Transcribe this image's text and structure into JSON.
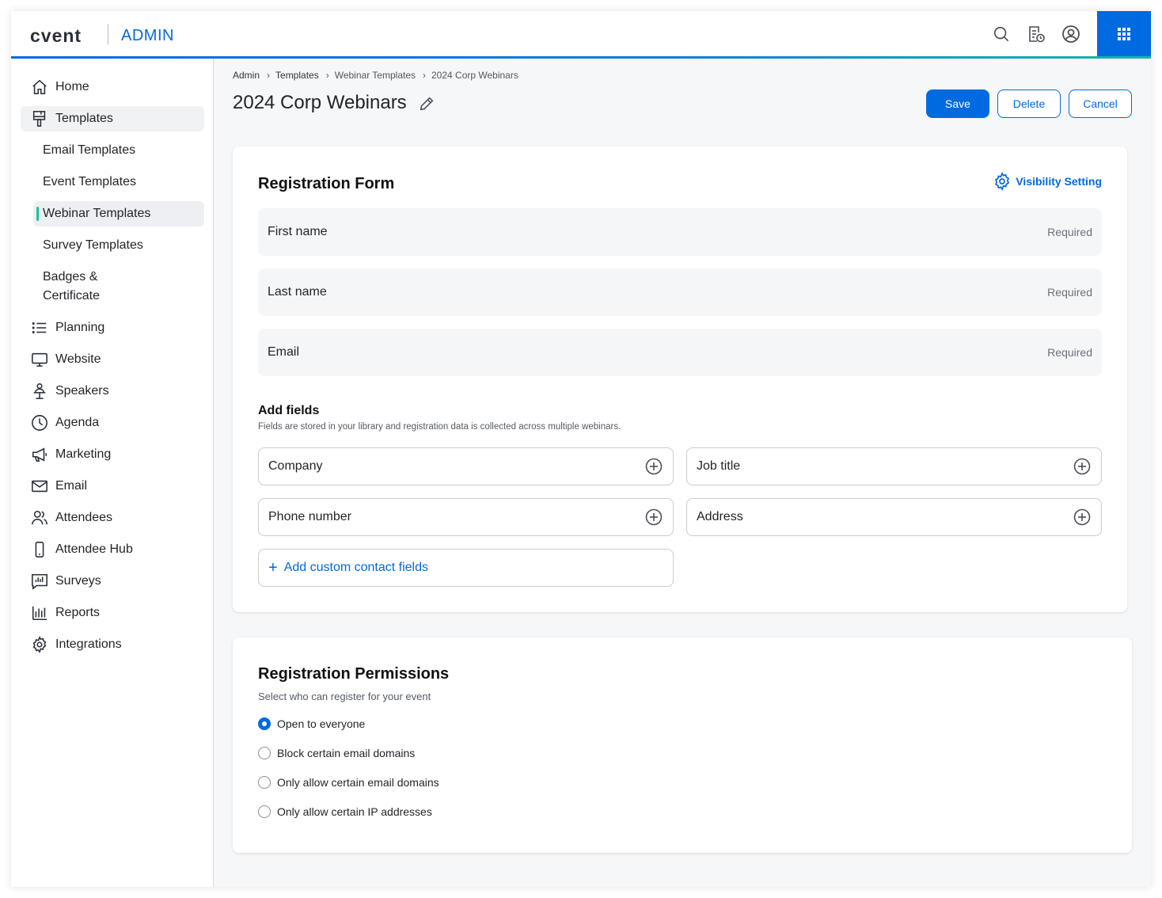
{
  "header": {
    "logo": "cvent",
    "app_label": "ADMIN",
    "icons": [
      "search-icon",
      "report-schedule-icon",
      "user-account-icon",
      "apps-grid-icon"
    ]
  },
  "colors": {
    "brand_blue": "#006ae1",
    "active_marker": "#17c39a"
  },
  "sidebar": {
    "items": [
      {
        "label": "Home",
        "icon": "home-icon"
      },
      {
        "label": "Templates",
        "icon": "paint-brush-icon"
      },
      {
        "label": "Planning",
        "icon": "list-icon"
      },
      {
        "label": "Website",
        "icon": "monitor-icon"
      },
      {
        "label": "Speakers",
        "icon": "speaker-icon"
      },
      {
        "label": "Agenda",
        "icon": "clock-icon"
      },
      {
        "label": "Marketing",
        "icon": "megaphone-icon"
      },
      {
        "label": "Email",
        "icon": "envelope-icon"
      },
      {
        "label": "Attendees",
        "icon": "people-icon"
      },
      {
        "label": "Attendee Hub",
        "icon": "mobile-icon"
      },
      {
        "label": "Surveys",
        "icon": "survey-chart-icon"
      },
      {
        "label": "Reports",
        "icon": "bar-chart-icon"
      },
      {
        "label": "Integrations",
        "icon": "gear-icon"
      }
    ],
    "template_subitems": [
      {
        "label": "Email Templates"
      },
      {
        "label": "Event Templates"
      },
      {
        "label": "Webinar Templates"
      },
      {
        "label": "Survey Templates"
      },
      {
        "label": "Badges & Certificate"
      }
    ]
  },
  "breadcrumb": [
    "Admin",
    "Templates",
    "Webinar Templates",
    "2024 Corp Webinars"
  ],
  "page": {
    "title": "2024 Corp Webinars",
    "save_label": "Save",
    "delete_label": "Delete",
    "cancel_label": "Cancel"
  },
  "registration_form": {
    "title": "Registration Form",
    "visibility_label": "Visibility Setting",
    "required_fields": [
      {
        "name": "First name",
        "status": "Required"
      },
      {
        "name": "Last name",
        "status": "Required"
      },
      {
        "name": "Email",
        "status": "Required"
      }
    ],
    "add_fields_title": "Add fields",
    "add_fields_helper": "Fields are stored in your library and registration data is collected across multiple webinars.",
    "optional_fields": [
      {
        "name": "Company"
      },
      {
        "name": "Job title"
      },
      {
        "name": "Phone number"
      },
      {
        "name": "Address"
      }
    ],
    "custom_fields_label": "Add custom contact fields"
  },
  "permissions": {
    "title": "Registration Permissions",
    "subtitle": "Select who can register for your event",
    "options": [
      {
        "label": "Open to everyone",
        "selected": true
      },
      {
        "label": "Block certain email domains",
        "selected": false
      },
      {
        "label": "Only allow certain email domains",
        "selected": false
      },
      {
        "label": "Only allow certain IP addresses",
        "selected": false
      }
    ]
  }
}
